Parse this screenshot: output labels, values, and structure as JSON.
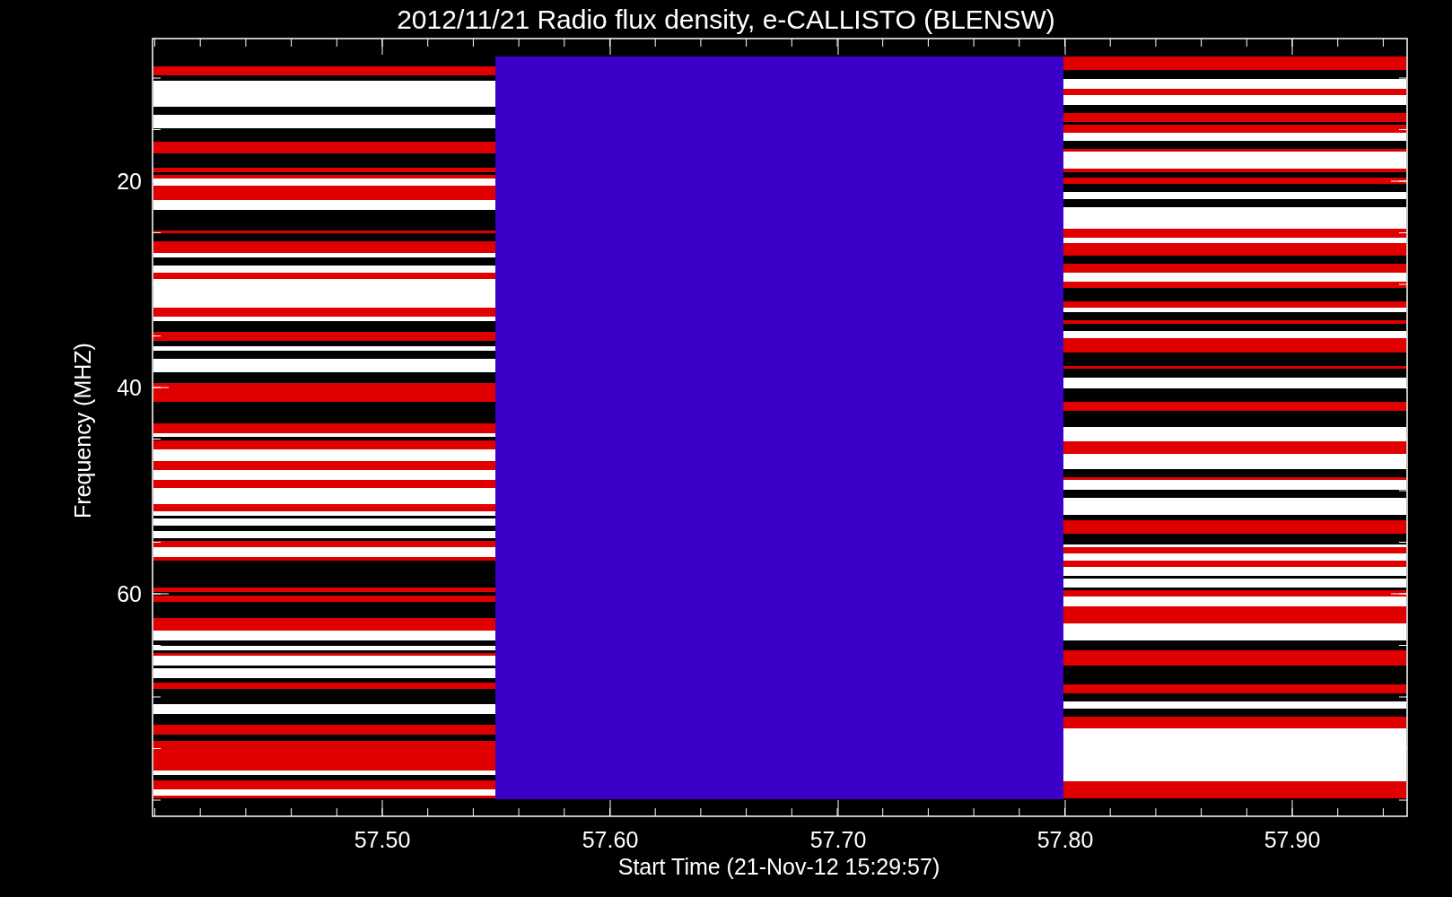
{
  "title": "2012/11/21  Radio flux density, e-CALLISTO (BLENSW)",
  "y_axis": {
    "label": "Frequency (MHZ)",
    "ticks": [
      "20",
      "40",
      "60"
    ]
  },
  "x_axis": {
    "label": "Start Time (21-Nov-12 15:29:57)",
    "ticks": [
      "57.50",
      "57.60",
      "57.70",
      "57.80",
      "57.90"
    ]
  }
}
